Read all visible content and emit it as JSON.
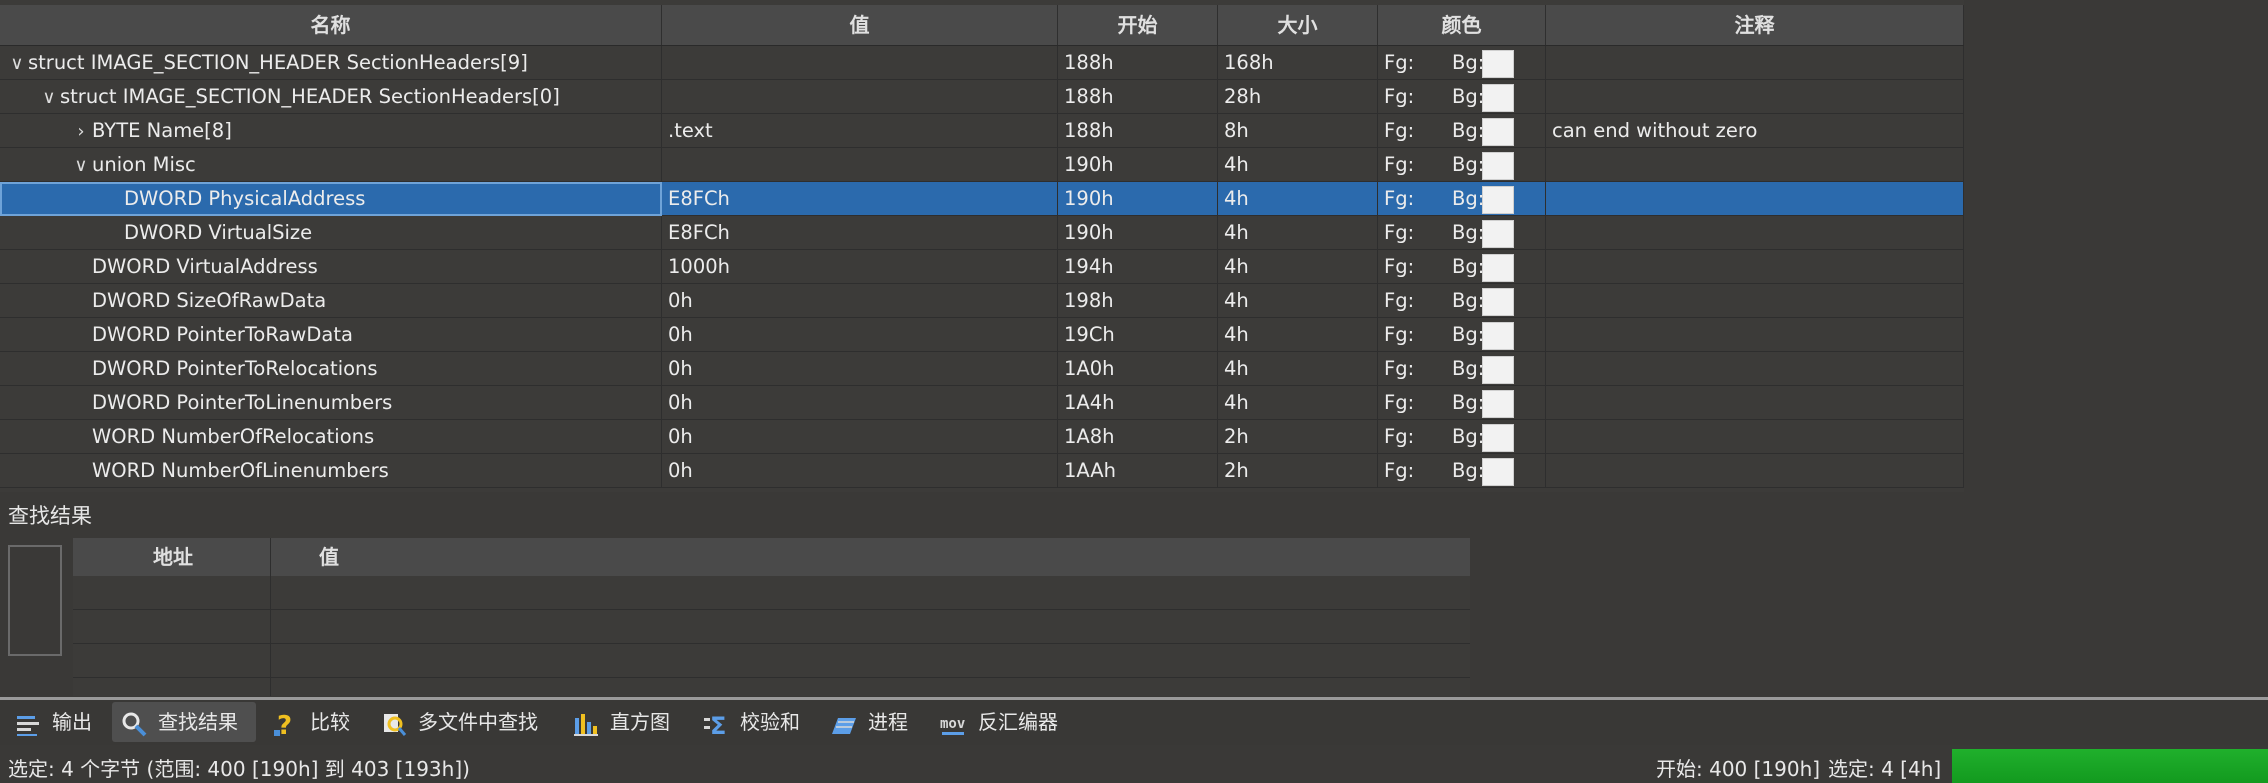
{
  "template": {
    "columns": [
      "名称",
      "值",
      "开始",
      "大小",
      "颜色",
      "注释"
    ],
    "rows": [
      {
        "indent": 0,
        "toggle": "expanded",
        "name": "struct IMAGE_SECTION_HEADER SectionHeaders[9]",
        "value": "",
        "start": "188h",
        "size": "168h",
        "fg": "Fg:",
        "bg": "Bg:",
        "comment": ""
      },
      {
        "indent": 1,
        "toggle": "expanded",
        "name": "struct IMAGE_SECTION_HEADER SectionHeaders[0]",
        "value": "",
        "start": "188h",
        "size": "28h",
        "fg": "Fg:",
        "bg": "Bg:",
        "comment": ""
      },
      {
        "indent": 2,
        "toggle": "collapsed",
        "name": "BYTE Name[8]",
        "value": ".text",
        "start": "188h",
        "size": "8h",
        "fg": "Fg:",
        "bg": "Bg:",
        "comment": "can end without zero"
      },
      {
        "indent": 2,
        "toggle": "expanded",
        "name": "union Misc",
        "value": "",
        "start": "190h",
        "size": "4h",
        "fg": "Fg:",
        "bg": "Bg:",
        "comment": ""
      },
      {
        "indent": 3,
        "toggle": "leaf",
        "name": "DWORD PhysicalAddress",
        "value": "E8FCh",
        "start": "190h",
        "size": "4h",
        "fg": "Fg:",
        "bg": "Bg:",
        "comment": "",
        "selected": true
      },
      {
        "indent": 3,
        "toggle": "leaf",
        "name": "DWORD VirtualSize",
        "value": "E8FCh",
        "start": "190h",
        "size": "4h",
        "fg": "Fg:",
        "bg": "Bg:",
        "comment": ""
      },
      {
        "indent": 2,
        "toggle": "leaf",
        "name": "DWORD VirtualAddress",
        "value": "1000h",
        "start": "194h",
        "size": "4h",
        "fg": "Fg:",
        "bg": "Bg:",
        "comment": ""
      },
      {
        "indent": 2,
        "toggle": "leaf",
        "name": "DWORD SizeOfRawData",
        "value": "0h",
        "start": "198h",
        "size": "4h",
        "fg": "Fg:",
        "bg": "Bg:",
        "comment": ""
      },
      {
        "indent": 2,
        "toggle": "leaf",
        "name": "DWORD PointerToRawData",
        "value": "0h",
        "start": "19Ch",
        "size": "4h",
        "fg": "Fg:",
        "bg": "Bg:",
        "comment": ""
      },
      {
        "indent": 2,
        "toggle": "leaf",
        "name": "DWORD PointerToRelocations",
        "value": "0h",
        "start": "1A0h",
        "size": "4h",
        "fg": "Fg:",
        "bg": "Bg:",
        "comment": ""
      },
      {
        "indent": 2,
        "toggle": "leaf",
        "name": "DWORD PointerToLinenumbers",
        "value": "0h",
        "start": "1A4h",
        "size": "4h",
        "fg": "Fg:",
        "bg": "Bg:",
        "comment": ""
      },
      {
        "indent": 2,
        "toggle": "leaf",
        "name": "WORD NumberOfRelocations",
        "value": "0h",
        "start": "1A8h",
        "size": "2h",
        "fg": "Fg:",
        "bg": "Bg:",
        "comment": ""
      },
      {
        "indent": 2,
        "toggle": "leaf",
        "name": "WORD NumberOfLinenumbers",
        "value": "0h",
        "start": "1AAh",
        "size": "2h",
        "fg": "Fg:",
        "bg": "Bg:",
        "comment": ""
      }
    ]
  },
  "find_results": {
    "title": "查找结果",
    "columns": [
      "地址",
      "值"
    ]
  },
  "tabs": [
    {
      "label": "输出",
      "icon": "output-icon",
      "active": false
    },
    {
      "label": "查找结果",
      "icon": "find-results-icon",
      "active": true
    },
    {
      "label": "比较",
      "icon": "compare-icon",
      "active": false
    },
    {
      "label": "多文件中查找",
      "icon": "find-in-files-icon",
      "active": false
    },
    {
      "label": "直方图",
      "icon": "histogram-icon",
      "active": false
    },
    {
      "label": "校验和",
      "icon": "checksum-icon",
      "active": false
    },
    {
      "label": "进程",
      "icon": "process-icon",
      "active": false
    },
    {
      "label": "反汇编器",
      "icon": "disassembler-icon",
      "active": false
    }
  ],
  "status": {
    "selection": "选定: 4 个字节 (范围: 400 [190h] 到 403 [193h])",
    "start": "开始: 400 [190h]",
    "selected": "选定: 4 [4h]"
  },
  "colors": {
    "selection": "#2b6aad",
    "progress": "#1aa826"
  }
}
